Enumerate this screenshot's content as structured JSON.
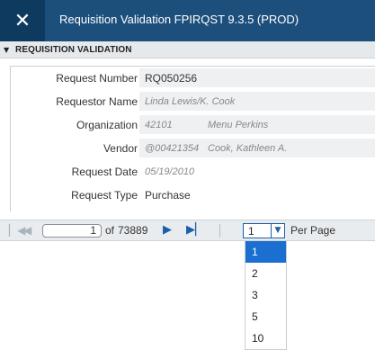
{
  "window": {
    "close_glyph": "✕",
    "title": "Requisition Validation FPIRQST 9.3.5 (PROD)"
  },
  "section": {
    "caret": "▼",
    "title": "REQUISITION VALIDATION"
  },
  "fields": {
    "request_number": {
      "label": "Request Number",
      "value": "RQ050256"
    },
    "requestor_name": {
      "label": "Requestor Name",
      "value": "Linda Lewis/K. Cook"
    },
    "organization": {
      "label": "Organization",
      "code": "42101",
      "name": "Menu Perkins"
    },
    "vendor": {
      "label": "Vendor",
      "code": "@00421354",
      "name": "Cook, Kathleen A."
    },
    "request_date": {
      "label": "Request Date",
      "value": "05/19/2010"
    },
    "request_type": {
      "label": "Request Type",
      "value": "Purchase"
    }
  },
  "pager": {
    "current_page": "1",
    "of_label": "of",
    "total_pages": "73889",
    "per_page_value": "1",
    "per_page_label": "Per Page",
    "per_page_options": [
      "1",
      "2",
      "3",
      "5",
      "10"
    ],
    "icons": {
      "first": "first-page-icon",
      "prev": "previous-page-icon",
      "next": "next-page-icon",
      "last": "last-page-icon"
    }
  },
  "colors": {
    "titlebar": "#1d4f7c",
    "close_button": "#0f3a5f",
    "field_bg": "#eef0f2",
    "accent": "#1b5fa8",
    "selected_option": "#1b6fd0"
  }
}
